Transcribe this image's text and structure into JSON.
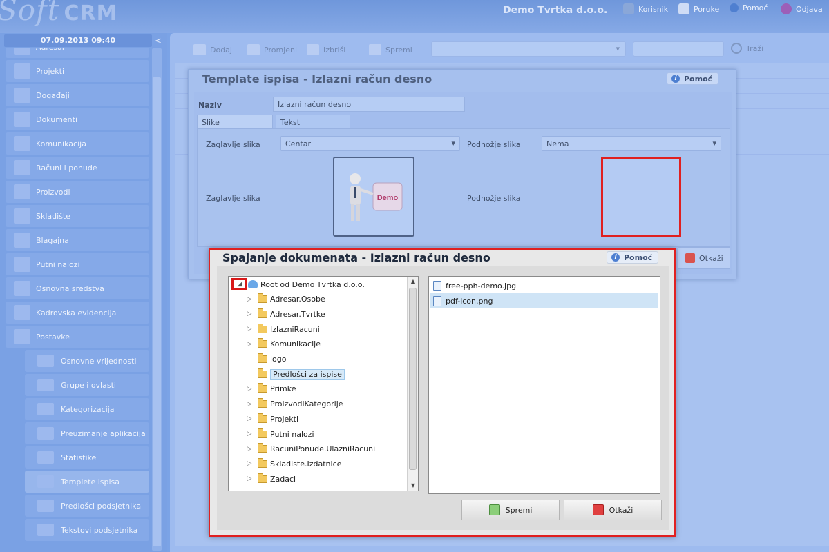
{
  "app": {
    "logo_main": "Soft",
    "logo_sub": "CRM",
    "company": "Demo Tvrtka d.o.o."
  },
  "topnav": {
    "users": "Korisnik",
    "messages": "Poruke",
    "help": "Pomoć",
    "logout": "Odjava"
  },
  "sidebar": {
    "datetime": "07.09.2013 09:40",
    "collapse": "<",
    "items": [
      {
        "label": "Adresar"
      },
      {
        "label": "Projekti"
      },
      {
        "label": "Događaji"
      },
      {
        "label": "Dokumenti"
      },
      {
        "label": "Komunikacija"
      },
      {
        "label": "Računi i ponude"
      },
      {
        "label": "Proizvodi"
      },
      {
        "label": "Skladište"
      },
      {
        "label": "Blagajna"
      },
      {
        "label": "Putni nalozi"
      },
      {
        "label": "Osnovna sredstva"
      },
      {
        "label": "Kadrovska evidencija"
      },
      {
        "label": "Postavke"
      }
    ],
    "subitems": [
      {
        "label": "Osnovne vrijednosti"
      },
      {
        "label": "Grupe i ovlasti"
      },
      {
        "label": "Kategorizacija"
      },
      {
        "label": "Preuzimanje aplikacija"
      },
      {
        "label": "Statistike"
      },
      {
        "label": "Templete ispisa"
      },
      {
        "label": "Predlošci podsjetnika"
      },
      {
        "label": "Tekstovi podsjetnika"
      }
    ]
  },
  "toolbar": {
    "add": "Dodaj",
    "edit": "Promjeni",
    "delete": "Izbriši",
    "save": "Spremi",
    "search": "Traži"
  },
  "template_dialog": {
    "title": "Template ispisa - Izlazni račun desno",
    "help": "Pomoć",
    "name_label": "Naziv",
    "name_value": "Izlazni račun desno",
    "tabs": {
      "images": "Slike",
      "text": "Tekst"
    },
    "header_image_label": "Zaglavlje slika",
    "header_align": "Centar",
    "footer_image_label": "Podnožje slika",
    "footer_align": "Nema",
    "header_image_label2": "Zaglavlje slika",
    "footer_image_label2": "Podnožje slika",
    "header_image_text": "Demo",
    "cancel": "Otkaži"
  },
  "merge_dialog": {
    "title": "Spajanje dokumenata - Izlazni račun desno",
    "help": "Pomoć",
    "tree": [
      {
        "label": "Root od Demo Tvrtka d.o.o.",
        "expanded": true,
        "root": true
      },
      {
        "label": "Adresar.Osobe",
        "expandable": true
      },
      {
        "label": "Adresar.Tvrtke",
        "expandable": true
      },
      {
        "label": "IzlazniRacuni",
        "expandable": true
      },
      {
        "label": "Komunikacije",
        "expandable": true
      },
      {
        "label": "logo",
        "expandable": false
      },
      {
        "label": "Predlošci za ispise",
        "expandable": false,
        "selected": true
      },
      {
        "label": "Primke",
        "expandable": true
      },
      {
        "label": "ProizvodiKategorije",
        "expandable": true
      },
      {
        "label": "Projekti",
        "expandable": true
      },
      {
        "label": "Putni nalozi",
        "expandable": true
      },
      {
        "label": "RacuniPonude.UlazniRacuni",
        "expandable": true
      },
      {
        "label": "Skladiste.Izdatnice",
        "expandable": true
      },
      {
        "label": "Zadaci",
        "expandable": true
      }
    ],
    "files": [
      {
        "name": "free-pph-demo.jpg"
      },
      {
        "name": "pdf-icon.png",
        "selected": true
      }
    ],
    "save": "Spremi",
    "cancel": "Otkaži"
  },
  "colors": {
    "highlight": "#e02020",
    "selection": "#cfe4f6",
    "folder": "#f3c95e"
  }
}
